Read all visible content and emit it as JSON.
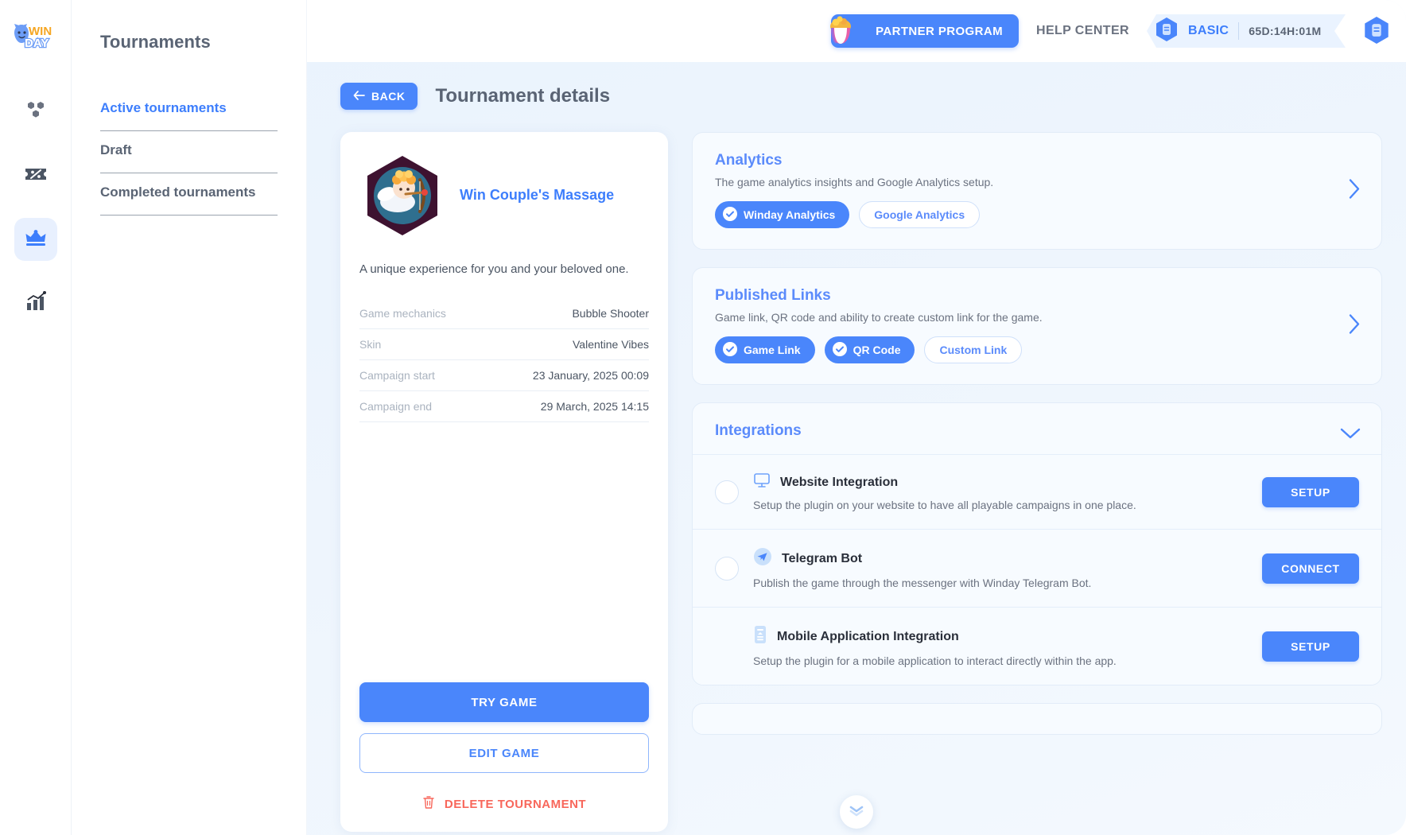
{
  "brand": {
    "logo_win": "WIN",
    "logo_day": "DAY"
  },
  "rail": {
    "items": [
      {
        "icon": "hexagons-icon",
        "name": "games",
        "active": false
      },
      {
        "icon": "ticket-percent-icon",
        "name": "promo",
        "active": false
      },
      {
        "icon": "crown-icon",
        "name": "tournaments",
        "active": true
      },
      {
        "icon": "bar-chart-icon",
        "name": "analytics",
        "active": false
      }
    ]
  },
  "subnav": {
    "title": "Tournaments",
    "items": [
      {
        "label": "Active tournaments",
        "active": true
      },
      {
        "label": "Draft",
        "active": false
      },
      {
        "label": "Completed tournaments",
        "active": false
      }
    ]
  },
  "topbar": {
    "partner_label": "PARTNER PROGRAM",
    "help_label": "HELP CENTER",
    "plan_name": "BASIC",
    "plan_timer": "65D:14H:01M"
  },
  "page": {
    "back_label": "BACK",
    "title": "Tournament details"
  },
  "game": {
    "name": "Win Couple's Massage",
    "description": "A unique experience for you and your beloved one.",
    "specs": [
      {
        "key": "Game mechanics",
        "value": "Bubble Shooter"
      },
      {
        "key": "Skin",
        "value": "Valentine Vibes"
      },
      {
        "key": "Campaign start",
        "value": "23 January, 2025 00:09"
      },
      {
        "key": "Campaign end",
        "value": "29 March, 2025 14:15"
      }
    ],
    "try_label": "TRY GAME",
    "edit_label": "EDIT GAME",
    "delete_label": "DELETE TOURNAMENT"
  },
  "analytics": {
    "title": "Analytics",
    "subtitle": "The game analytics insights and Google Analytics setup.",
    "pills": [
      {
        "label": "Winday Analytics",
        "on": true
      },
      {
        "label": "Google Analytics",
        "on": false
      }
    ]
  },
  "published_links": {
    "title": "Published Links",
    "subtitle": "Game link, QR code and ability to create custom link for the game.",
    "pills": [
      {
        "label": "Game Link",
        "on": true
      },
      {
        "label": "QR Code",
        "on": true
      },
      {
        "label": "Custom Link",
        "on": false
      }
    ]
  },
  "integrations": {
    "title": "Integrations",
    "rows": [
      {
        "icon": "monitor-icon",
        "title": "Website Integration",
        "desc": "Setup the plugin on your website to have all playable campaigns in one place.",
        "action": "SETUP"
      },
      {
        "icon": "telegram-icon",
        "title": "Telegram Bot",
        "desc": "Publish the game through the messenger with Winday Telegram Bot.",
        "action": "CONNECT"
      },
      {
        "icon": "mobile-app-icon",
        "title": "Mobile Application Integration",
        "desc": "Setup the plugin for a mobile application to interact directly within the app.",
        "action": "SETUP"
      }
    ]
  },
  "colors": {
    "accent": "#4a86fb",
    "accent_light": "#5b8bfb",
    "danger": "#f8675b",
    "text_muted": "#6b7280",
    "panel_bg": "#f7fbff"
  }
}
